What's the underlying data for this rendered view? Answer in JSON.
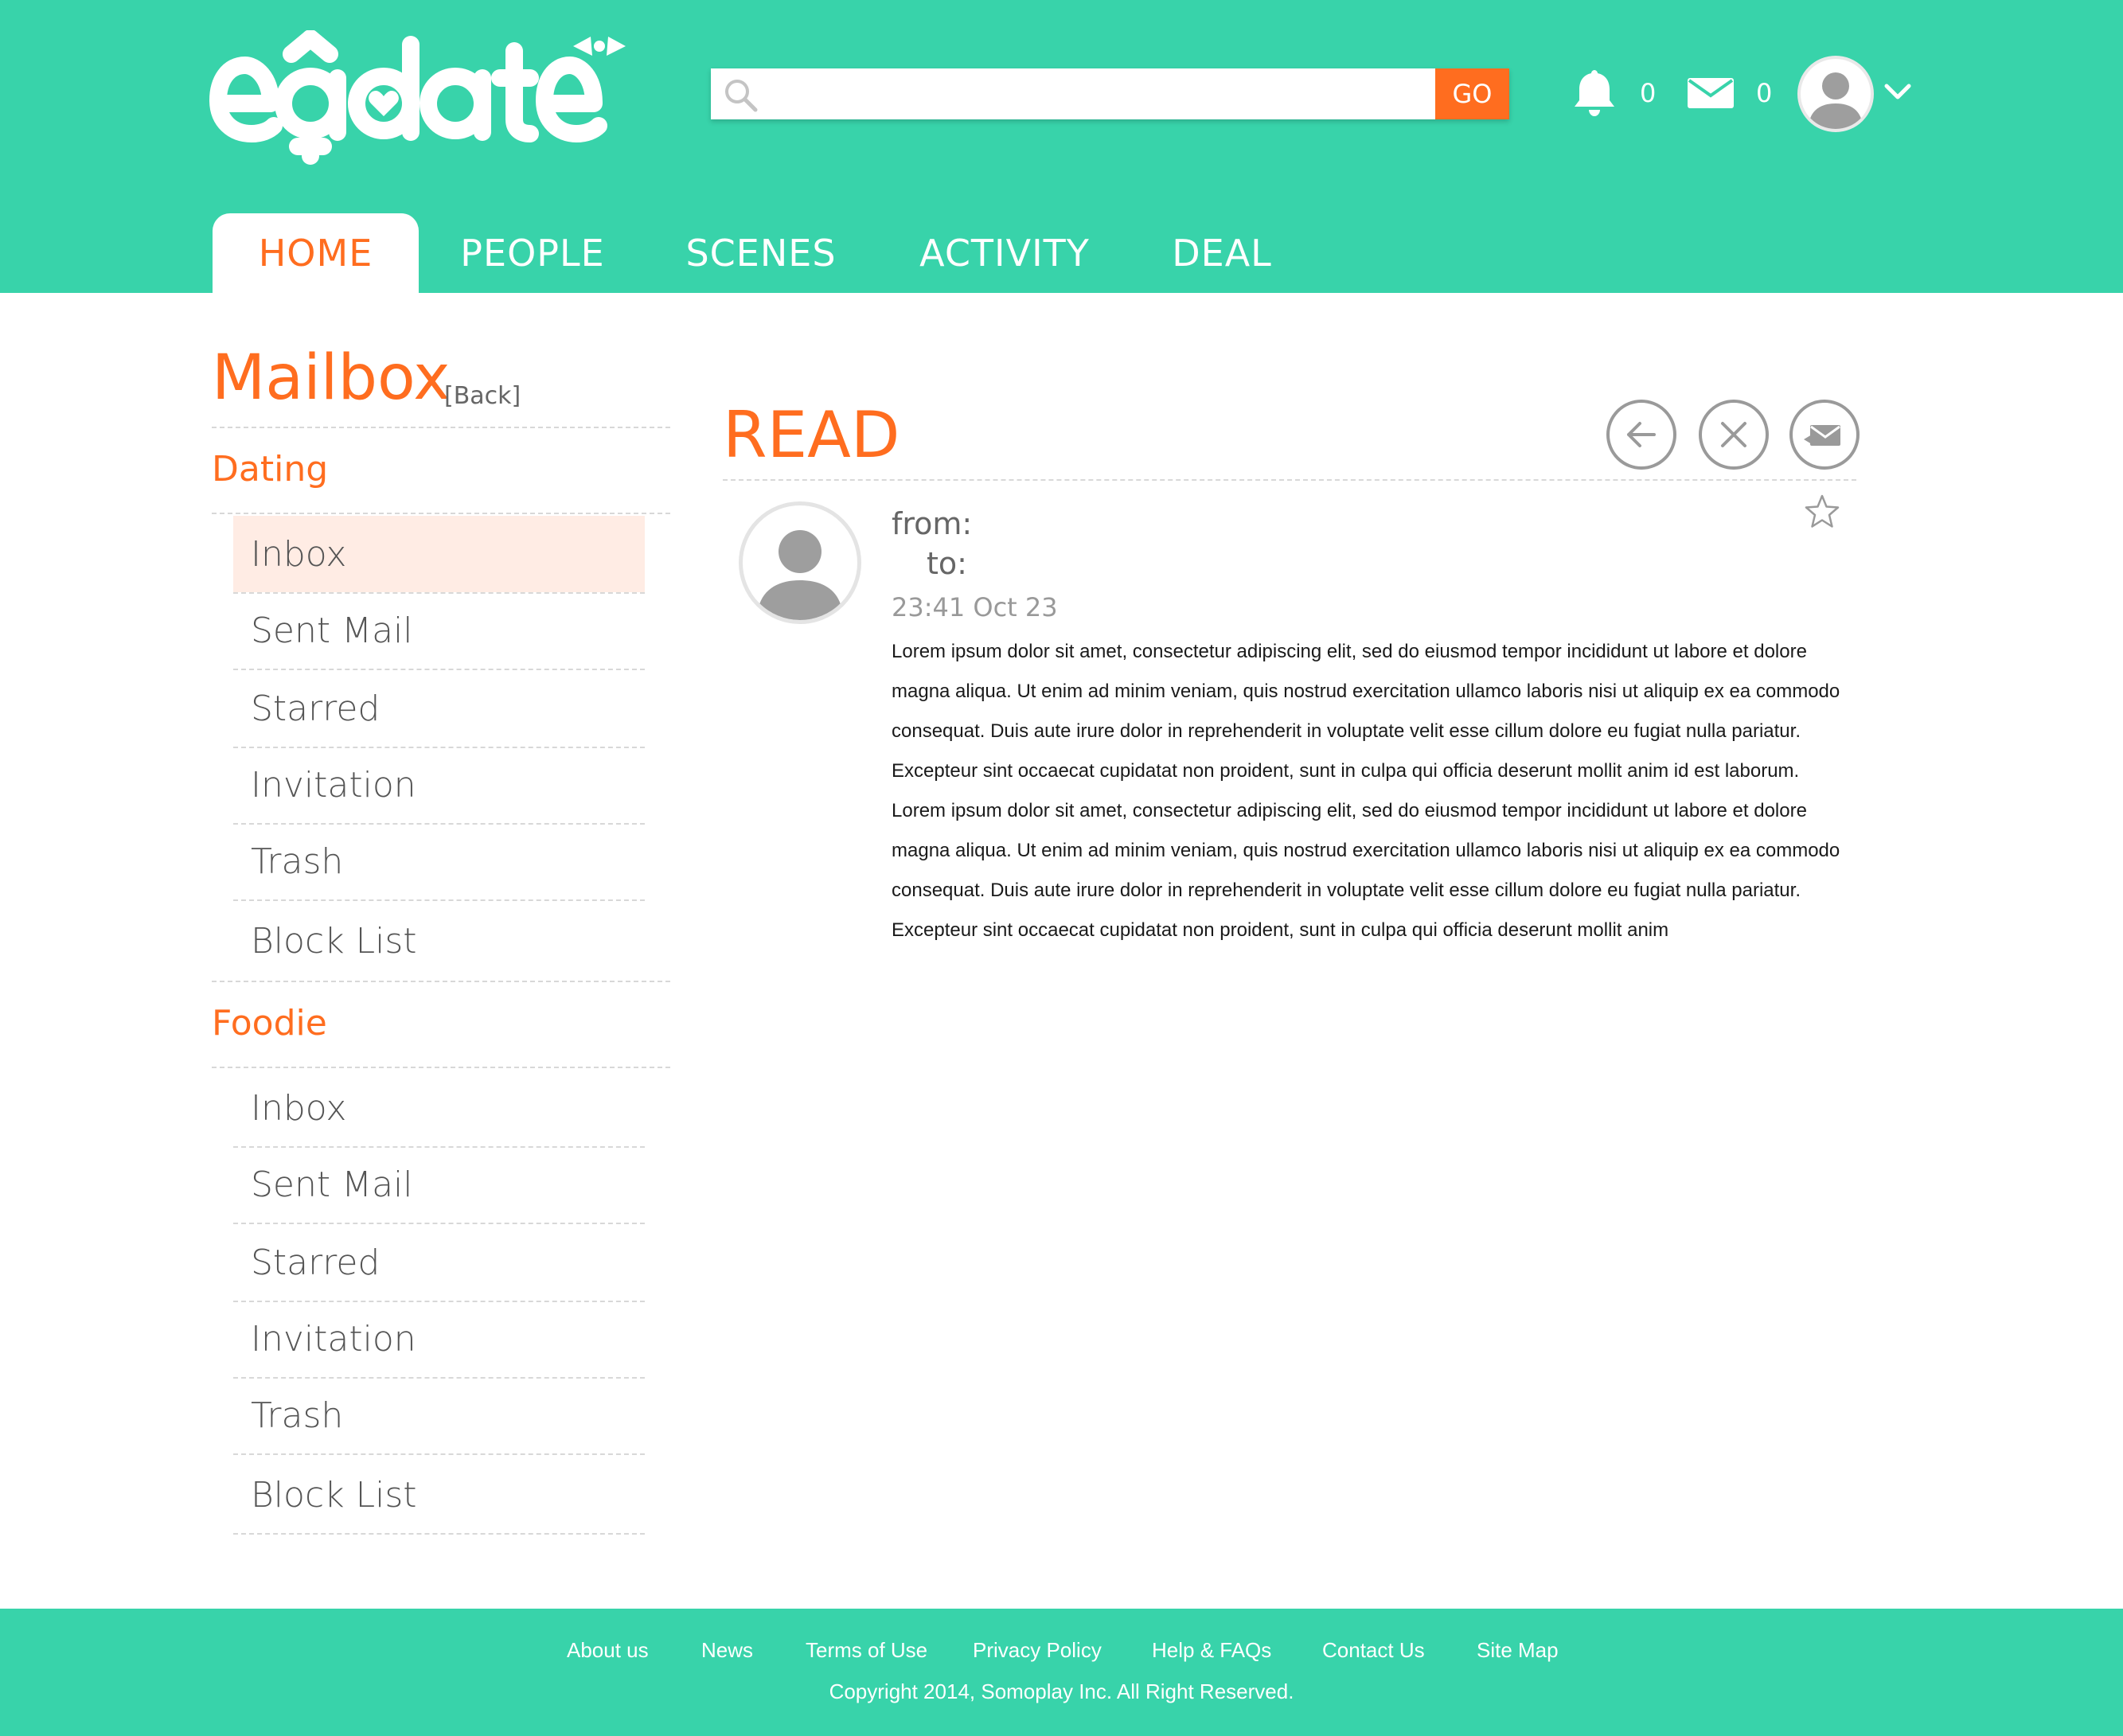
{
  "brand": {
    "logo_text": "eadate",
    "accent": "#ff6d1f",
    "primary": "#38d3aa"
  },
  "header": {
    "search": {
      "placeholder": "",
      "go_label": "GO"
    },
    "notifications_count": "0",
    "messages_count": "0"
  },
  "nav": {
    "tabs": [
      "HOME",
      "PEOPLE",
      "SCENES",
      "ACTIVITY",
      "DEAL"
    ],
    "active": "HOME"
  },
  "sidebar": {
    "title": "Mailbox",
    "back_label": "[Back]",
    "sections": [
      {
        "title": "Dating",
        "items": [
          "Inbox",
          "Sent Mail",
          "Starred",
          "Invitation",
          "Trash",
          "Block List"
        ],
        "active_index": 0
      },
      {
        "title": "Foodie",
        "items": [
          "Inbox",
          "Sent Mail",
          "Starred",
          "Invitation",
          "Trash",
          "Block List"
        ]
      }
    ]
  },
  "message": {
    "heading": "READ",
    "from_label": "from:",
    "to_label": "to:",
    "date": "23:41 Oct 23",
    "paragraphs": [
      "Lorem ipsum dolor sit amet, consectetur adipiscing elit, sed do eiusmod tempor incididunt ut labore et dolore magna aliqua. Ut enim ad minim veniam, quis nostrud exercitation ullamco laboris nisi ut aliquip ex ea commodo consequat. Duis aute irure dolor in reprehenderit in voluptate velit esse cillum dolore eu fugiat nulla pariatur. Excepteur sint occaecat cupidatat non proident, sunt in culpa qui officia deserunt mollit anim id est laborum.",
      "Lorem ipsum dolor sit amet, consectetur adipiscing elit, sed do eiusmod tempor incididunt ut labore et dolore magna aliqua. Ut enim ad minim veniam, quis nostrud exercitation ullamco laboris nisi ut aliquip ex ea commodo consequat. Duis aute irure dolor in reprehenderit in voluptate velit esse cillum dolore eu fugiat nulla pariatur. Excepteur sint occaecat cupidatat non proident, sunt in culpa qui officia deserunt mollit anim"
    ]
  },
  "footer": {
    "links": [
      "About us",
      "News",
      "Terms of Use",
      "Privacy Policy",
      "Help & FAQs",
      "Contact Us",
      "Site Map"
    ],
    "copyright": "Copyright 2014, Somoplay Inc. All Right Reserved."
  }
}
